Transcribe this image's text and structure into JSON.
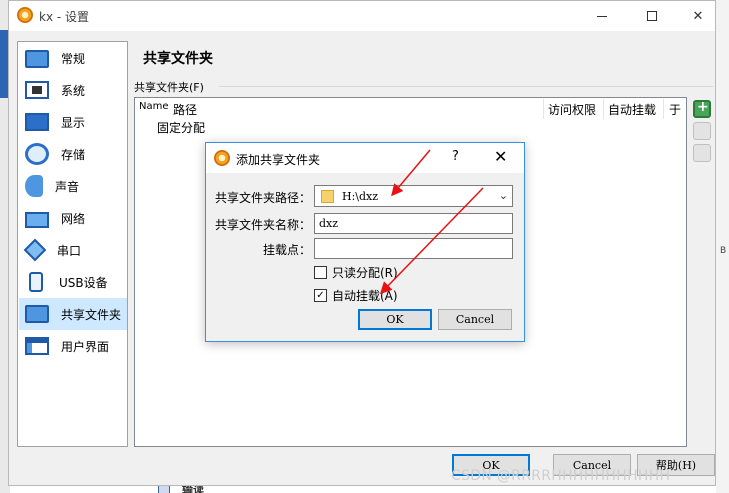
{
  "window": {
    "title": "kx - 设置"
  },
  "sidebar": {
    "items": [
      {
        "label": "常规",
        "icon": "monitor-icon"
      },
      {
        "label": "系统",
        "icon": "chip-icon"
      },
      {
        "label": "显示",
        "icon": "display-icon"
      },
      {
        "label": "存储",
        "icon": "disk-icon"
      },
      {
        "label": "声音",
        "icon": "speaker-icon"
      },
      {
        "label": "网络",
        "icon": "network-icon"
      },
      {
        "label": "串口",
        "icon": "serial-port-icon"
      },
      {
        "label": "USB设备",
        "icon": "usb-icon"
      },
      {
        "label": "共享文件夹",
        "icon": "shared-folder-icon"
      },
      {
        "label": "用户界面",
        "icon": "user-interface-icon"
      }
    ],
    "selected": "共享文件夹"
  },
  "main": {
    "title": "共享文件夹",
    "group_label": "共享文件夹(F)",
    "columns": {
      "name": "Name",
      "path": "路径",
      "access": "访问权限",
      "auto_mount": "自动挂载",
      "at": "于"
    },
    "rows": [
      "固定分配"
    ]
  },
  "footer": {
    "ok": "OK",
    "cancel": "Cancel",
    "help": "帮助(H)"
  },
  "background": {
    "right_edge_text": "B",
    "bottom_text": "输读",
    "watermark": "CSDN @RRRRHHHHHHHHHHH"
  },
  "dialog": {
    "title": "添加共享文件夹",
    "help_glyph": "?",
    "close_glyph": "✕",
    "path_label": "共享文件夹路径：",
    "path_value": "H:\\dxz",
    "name_label": "共享文件夹名称：",
    "name_value": "dxz",
    "mount_label": "挂载点：",
    "mount_value": "",
    "readonly_label": "只读分配(R)",
    "readonly_checked": false,
    "automount_label": "自动挂载(A)",
    "automount_checked": true,
    "ok": "OK",
    "cancel": "Cancel"
  },
  "colors": {
    "selection": "#cde8ff",
    "accent": "#0078d7",
    "annotation_arrow": "#e81212"
  }
}
